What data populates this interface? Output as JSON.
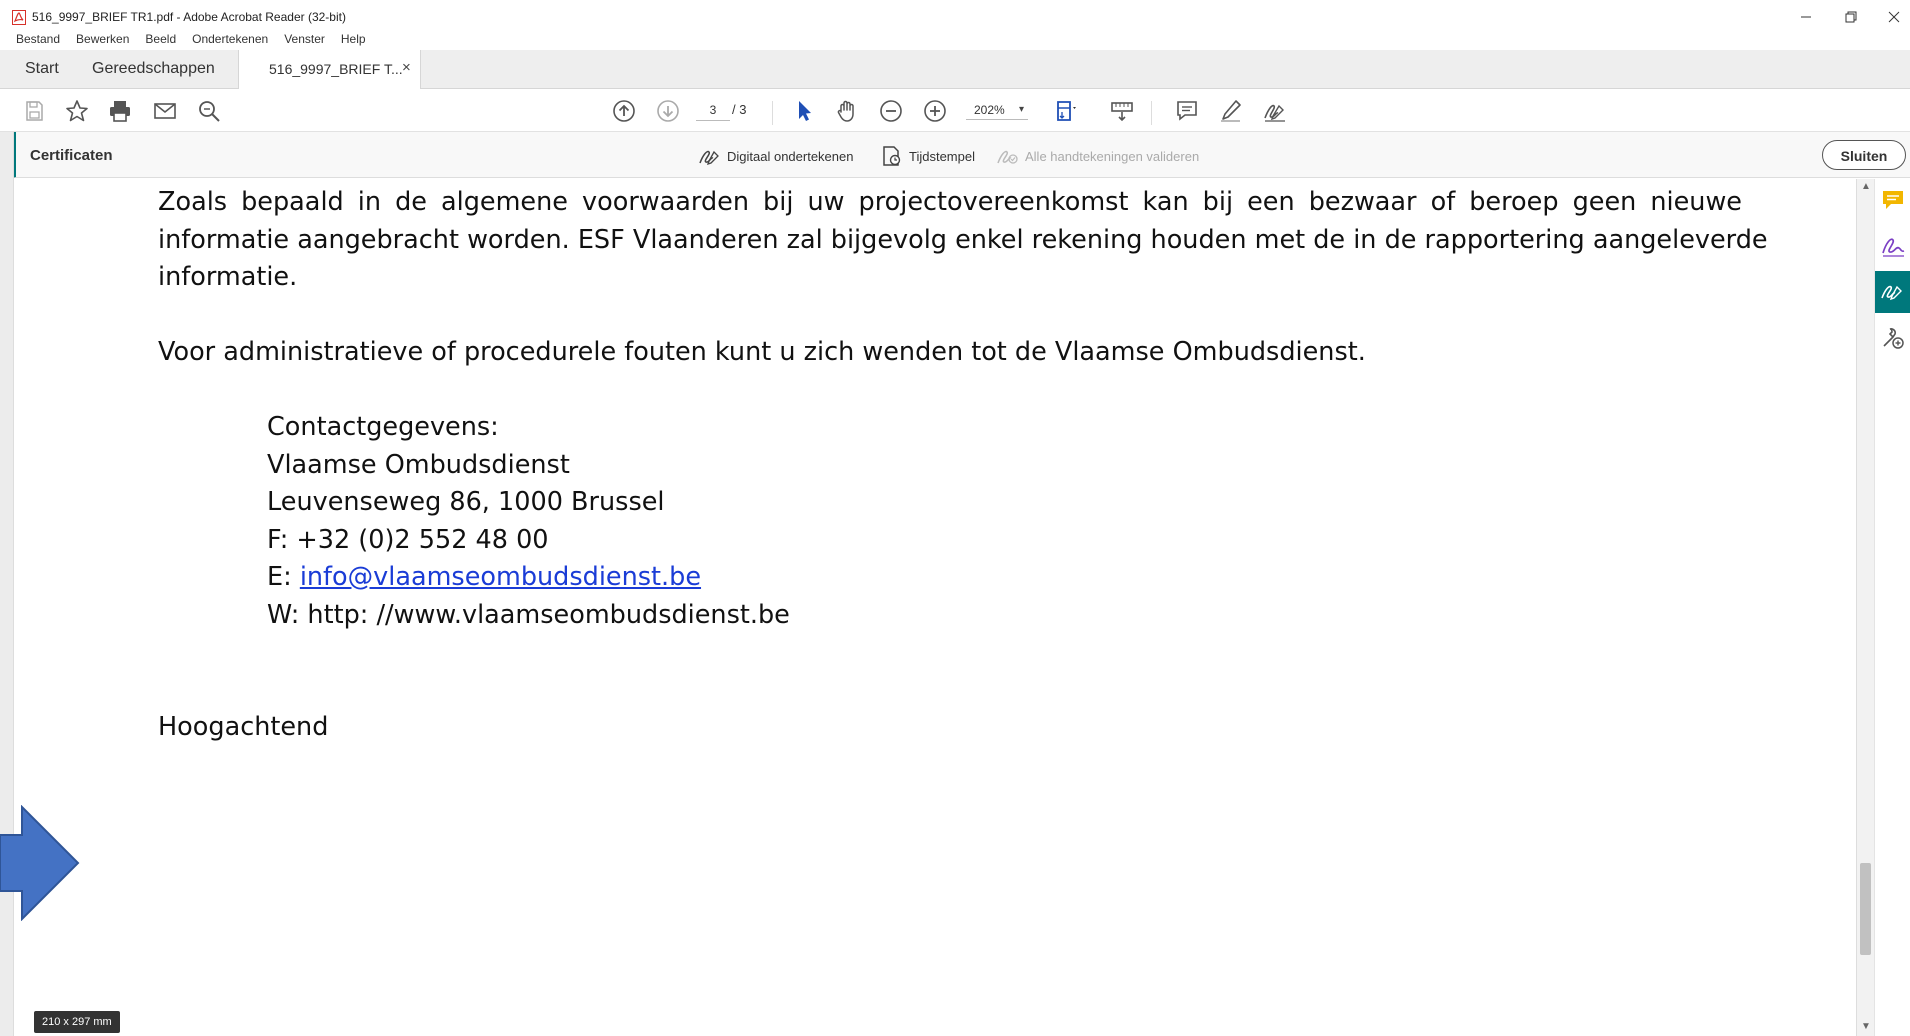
{
  "window": {
    "title": "516_9997_BRIEF TR1.pdf - Adobe Acrobat Reader (32-bit)",
    "controls": [
      "minimize",
      "restore",
      "close"
    ]
  },
  "menu": [
    "Bestand",
    "Bewerken",
    "Beeld",
    "Ondertekenen",
    "Venster",
    "Help"
  ],
  "tabs": {
    "home": "Start",
    "tools": "Gereedschappen",
    "document": "516_9997_BRIEF T...",
    "close": "×"
  },
  "toolbar": {
    "icons": [
      "save-icon",
      "bookmark-star-icon",
      "print-icon",
      "email-icon",
      "search-icon",
      "page-up-icon",
      "page-down-icon",
      "select-arrow-icon",
      "hand-tool-icon",
      "zoom-out-icon",
      "zoom-in-icon",
      "fit-page-icon",
      "scroll-mode-icon",
      "comment-icon",
      "highlight-pen-icon",
      "sign-icon"
    ],
    "page_current": "3",
    "page_total": "/ 3",
    "zoom": "202%"
  },
  "certificates": {
    "title": "Certificaten",
    "sign_digital": "Digitaal ondertekenen",
    "timestamp": "Tijdstempel",
    "validate_all": "Alle handtekeningen valideren",
    "close": "Sluiten"
  },
  "document": {
    "para1": {
      "lines": [
        "Zoals bepaald in de algemene voorwaarden bij uw projectovereenkomst kan bij een bezwaar of beroep geen nieuwe",
        "informatie aangebracht worden. ESF Vlaanderen zal bijgevolg enkel rekening houden met de in de rapportering aangeleverde",
        "informatie."
      ]
    },
    "para2": "Voor administratieve of procedurele fouten kunt u zich wenden tot de Vlaamse Ombudsdienst.",
    "contact": {
      "heading": "Contactgegevens:",
      "name": "Vlaamse Ombudsdienst",
      "address": "Leuvenseweg 86, 1000 Brussel",
      "phone": "F: +32 (0)2 552 48 00",
      "email_prefix": "E: ",
      "email": "info@vlaamseombudsdienst.be",
      "web": "W: http: //www.vlaamseombudsdienst.be"
    },
    "closing": "Hoogachtend"
  },
  "status": {
    "page_size": "210 x 297 mm"
  },
  "right_rail": [
    "comment-icon",
    "fill-sign-icon",
    "certificate-sign-icon",
    "more-tools-icon"
  ],
  "colors": {
    "accent_teal": "#00787c",
    "link_blue": "#1a3cd6",
    "arrow_blue": "#4472c4",
    "pdf_red": "#d7312a"
  }
}
